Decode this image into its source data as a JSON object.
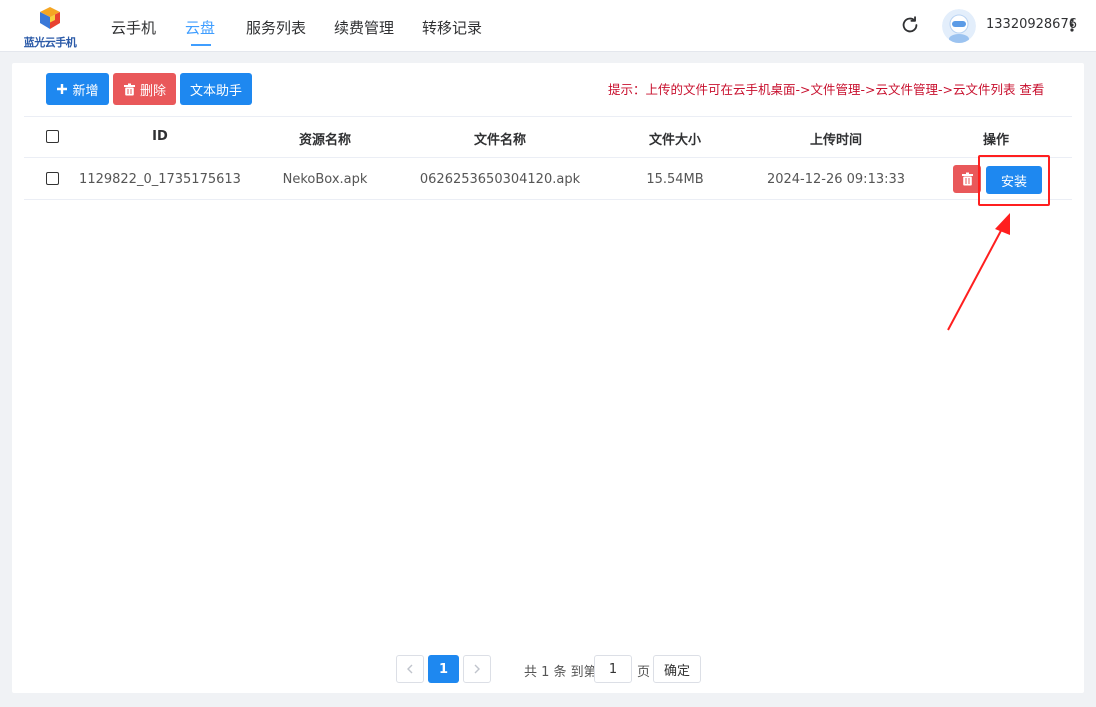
{
  "app": {
    "logo_text": "蓝光云手机"
  },
  "nav": [
    {
      "label": "云手机",
      "active": false
    },
    {
      "label": "云盘",
      "active": true
    },
    {
      "label": "服务列表",
      "active": false
    },
    {
      "label": "续费管理",
      "active": false
    },
    {
      "label": "转移记录",
      "active": false
    }
  ],
  "user": {
    "phone": "13320928676"
  },
  "toolbar": {
    "add_label": "新增",
    "delete_label": "删除",
    "text_helper_label": "文本助手"
  },
  "tip": "提示：上传的文件可在云手机桌面->文件管理->云文件管理->云文件列表 查看",
  "table": {
    "headers": [
      "ID",
      "资源名称",
      "文件名称",
      "文件大小",
      "上传时间",
      "操作"
    ],
    "rows": [
      {
        "id": "1129822_0_1735175613",
        "resource_name": "NekoBox.apk",
        "file_name": "0626253650304120.apk",
        "file_size": "15.54MB",
        "upload_time": "2024-12-26 09:13:33",
        "install_label": "安装"
      }
    ]
  },
  "pagination": {
    "current_page": "1",
    "total_text": "共 1 条 到第",
    "goto_value": "1",
    "page_suffix": "页",
    "confirm_label": "确定"
  },
  "colors": {
    "primary": "#1e88f0",
    "danger": "#e9585a",
    "tip": "#c8102e",
    "highlight": "#ff1f1f"
  }
}
